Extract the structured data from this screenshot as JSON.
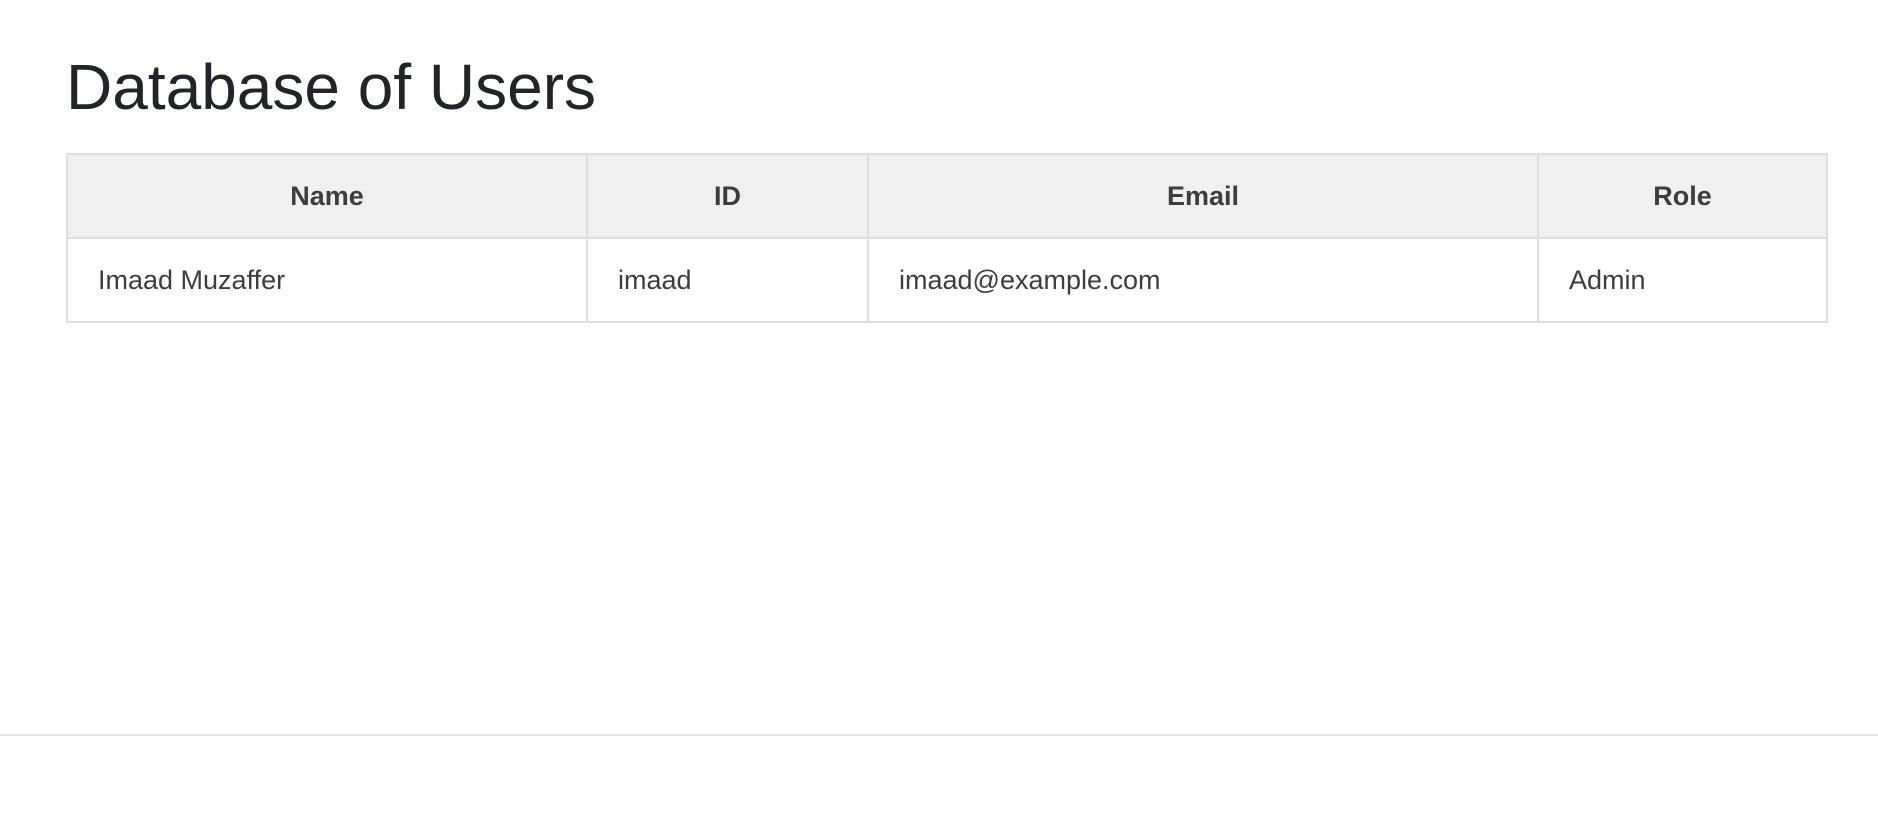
{
  "page": {
    "title": "Database of Users"
  },
  "table": {
    "columns": [
      "Name",
      "ID",
      "Email",
      "Role"
    ],
    "rows": [
      {
        "name": "Imaad Muzaffer",
        "id": "imaad",
        "email": "imaad@example.com",
        "role": "Admin"
      }
    ]
  }
}
